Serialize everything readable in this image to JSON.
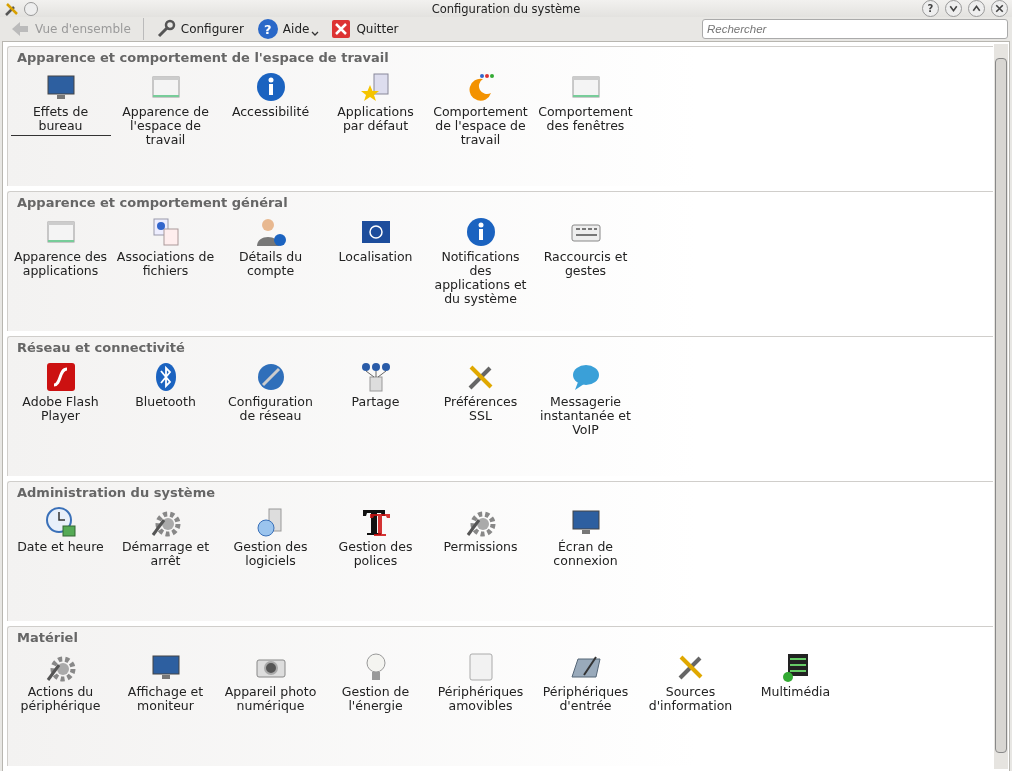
{
  "window": {
    "title": "Configuration du système",
    "controls": [
      {
        "kind": "help",
        "glyph": "?"
      },
      {
        "kind": "minimize"
      },
      {
        "kind": "maximize"
      },
      {
        "kind": "close"
      }
    ]
  },
  "toolbar": [
    {
      "label": "Vue d'ensemble",
      "disabled": true,
      "kind": "back"
    },
    {
      "label": "Configurer",
      "disabled": false,
      "kind": "configure"
    },
    {
      "label": "Aide",
      "disabled": false,
      "kind": "help",
      "glyph": "?"
    },
    {
      "label": "Quitter",
      "disabled": false,
      "kind": "quit"
    }
  ],
  "search": {
    "placeholder": "Rechercher"
  },
  "sections": [
    {
      "title": "Apparence et comportement de l'espace de travail",
      "items": [
        {
          "label": "Effets de bureau",
          "focused": true
        },
        {
          "label": "Apparence de l'espace de travail",
          "focused": false
        },
        {
          "label": "Accessibilité",
          "focused": false
        },
        {
          "label": "Applications par défaut",
          "focused": false
        },
        {
          "label": "Comportement de l'espace de travail",
          "focused": false
        },
        {
          "label": "Comportement des fenêtres",
          "focused": false
        }
      ]
    },
    {
      "title": "Apparence et comportement général",
      "items": [
        {
          "label": "Apparence des applications",
          "focused": false
        },
        {
          "label": "Associations de fichiers",
          "focused": false
        },
        {
          "label": "Détails du compte",
          "focused": false
        },
        {
          "label": "Localisation",
          "focused": false
        },
        {
          "label": "Notifications des applications et du système",
          "focused": false
        },
        {
          "label": "Raccourcis et gestes",
          "focused": false
        }
      ]
    },
    {
      "title": "Réseau et connectivité",
      "items": [
        {
          "label": "Adobe Flash Player",
          "focused": false
        },
        {
          "label": "Bluetooth",
          "focused": false
        },
        {
          "label": "Configuration de réseau",
          "focused": false
        },
        {
          "label": "Partage",
          "focused": false
        },
        {
          "label": "Préférences SSL",
          "focused": false
        },
        {
          "label": "Messagerie instantanée et VoIP",
          "focused": false
        }
      ]
    },
    {
      "title": "Administration du système",
      "items": [
        {
          "label": "Date et heure",
          "focused": false
        },
        {
          "label": "Démarrage et arrêt",
          "focused": false
        },
        {
          "label": "Gestion des logiciels",
          "focused": false
        },
        {
          "label": "Gestion des polices",
          "focused": false
        },
        {
          "label": "Permissions",
          "focused": false
        },
        {
          "label": "Écran de connexion",
          "focused": false
        }
      ]
    },
    {
      "title": "Matériel",
      "items": [
        {
          "label": "Actions du périphérique",
          "focused": false
        },
        {
          "label": "Affichage et moniteur",
          "focused": false
        },
        {
          "label": "Appareil photo numérique",
          "focused": false
        },
        {
          "label": "Gestion de l'énergie",
          "focused": false
        },
        {
          "label": "Périphériques amovibles",
          "focused": false
        },
        {
          "label": "Périphériques d'entrée",
          "focused": false
        },
        {
          "label": "Sources d'information",
          "focused": false
        },
        {
          "label": "Multimédia",
          "focused": false
        }
      ]
    }
  ]
}
